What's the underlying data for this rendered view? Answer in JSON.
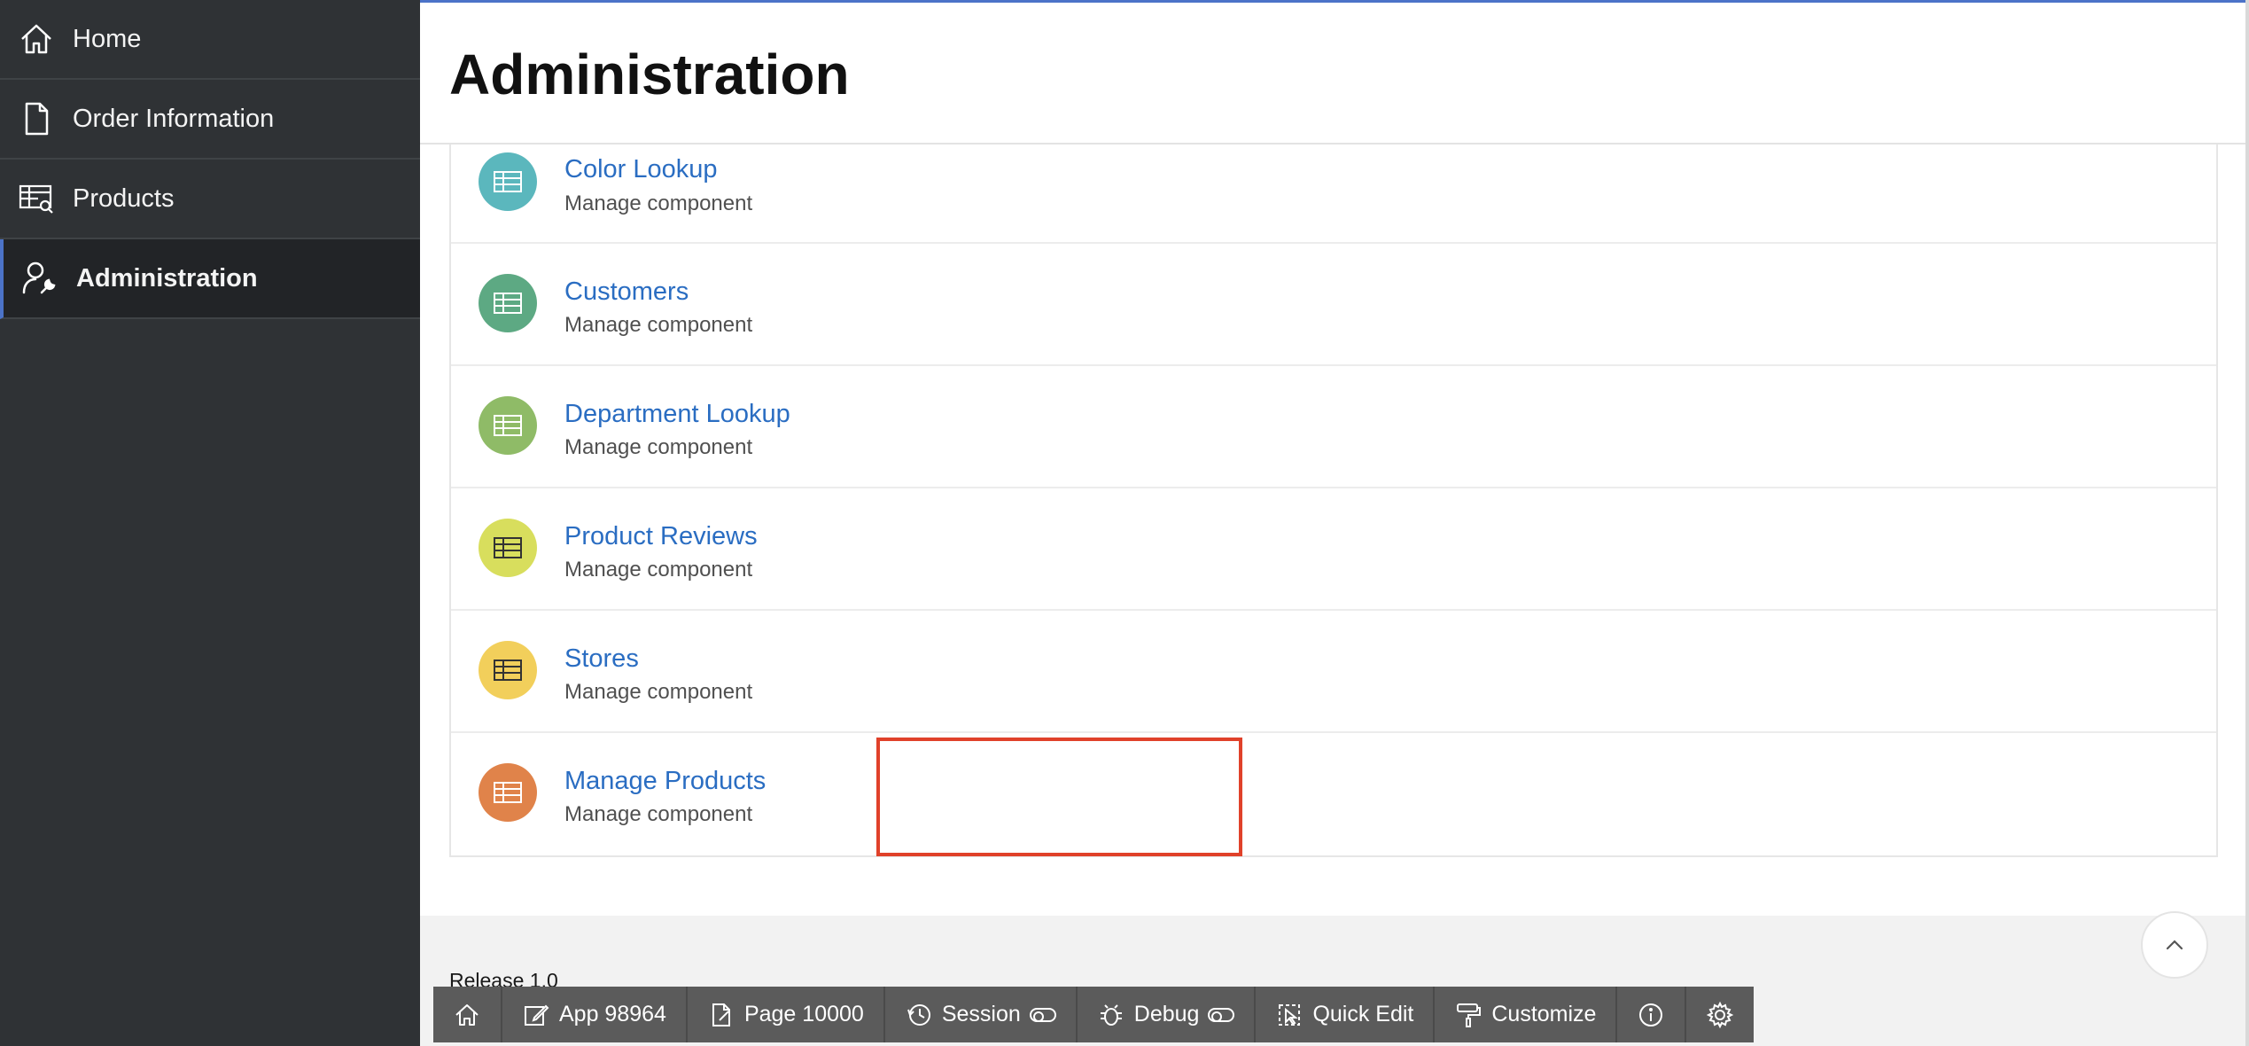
{
  "sidebar": {
    "items": [
      {
        "label": "Home",
        "icon": "home-icon"
      },
      {
        "label": "Order Information",
        "icon": "document-icon"
      },
      {
        "label": "Products",
        "icon": "table-search-icon"
      },
      {
        "label": "Administration",
        "icon": "user-wrench-icon",
        "active": true
      }
    ]
  },
  "header": {
    "title": "Administration"
  },
  "components": [
    {
      "title": "Color Lookup",
      "subtitle": "Manage component",
      "color": "#5bb7bd"
    },
    {
      "title": "Customers",
      "subtitle": "Manage component",
      "color": "#5da983"
    },
    {
      "title": "Department Lookup",
      "subtitle": "Manage component",
      "color": "#8fbb67"
    },
    {
      "title": "Product Reviews",
      "subtitle": "Manage component",
      "color": "#d8de5d"
    },
    {
      "title": "Stores",
      "subtitle": "Manage component",
      "color": "#f2cf5b"
    },
    {
      "title": "Manage Products",
      "subtitle": "Manage component",
      "color": "#e0834a"
    }
  ],
  "footer": {
    "release": "Release 1.0"
  },
  "devbar": {
    "app": "App 98964",
    "page": "Page 10000",
    "session": "Session",
    "debug": "Debug",
    "quick_edit": "Quick Edit",
    "customize": "Customize"
  },
  "colors": {
    "accent": "#4c73c8",
    "link": "#2a6dc2",
    "highlight": "#e0412a"
  }
}
